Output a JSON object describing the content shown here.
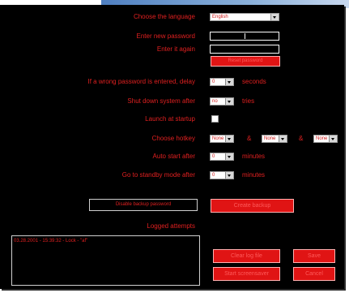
{
  "language": {
    "label": "Choose the language",
    "value": "English"
  },
  "password": {
    "new_label": "Enter new password",
    "again_label": "Enter it again",
    "reset_button": "Reset password"
  },
  "wrong_password": {
    "label": "If a wrong password is entered, delay",
    "value": "0",
    "unit": "seconds"
  },
  "shutdown": {
    "label": "Shut down system after",
    "value": "no",
    "unit": "tries"
  },
  "launch": {
    "label": "Launch at startup"
  },
  "hotkey": {
    "label": "Choose hotkey",
    "key1": "None",
    "amp1": "&",
    "key2": "None",
    "amp2": "&",
    "key3": "None"
  },
  "autostart": {
    "label": "Auto start after",
    "value": "0",
    "unit": "minutes"
  },
  "standby": {
    "label": "Go to standby mode after",
    "value": "0",
    "unit": "minutes"
  },
  "backup": {
    "disable_button": "Disable backup password",
    "create_button": "Create backup"
  },
  "attempts": {
    "label": "Logged attempts",
    "entries": [
      "03.28.2001 - 15:39:32 - Lock - \"af\""
    ]
  },
  "actions": {
    "clear_log": "Clear log file",
    "save": "Save",
    "start_screensaver": "Start screensaver",
    "cancel": "Cancel"
  },
  "colors": {
    "background": "#000000",
    "text": "#e02020",
    "button": "#e01414"
  }
}
